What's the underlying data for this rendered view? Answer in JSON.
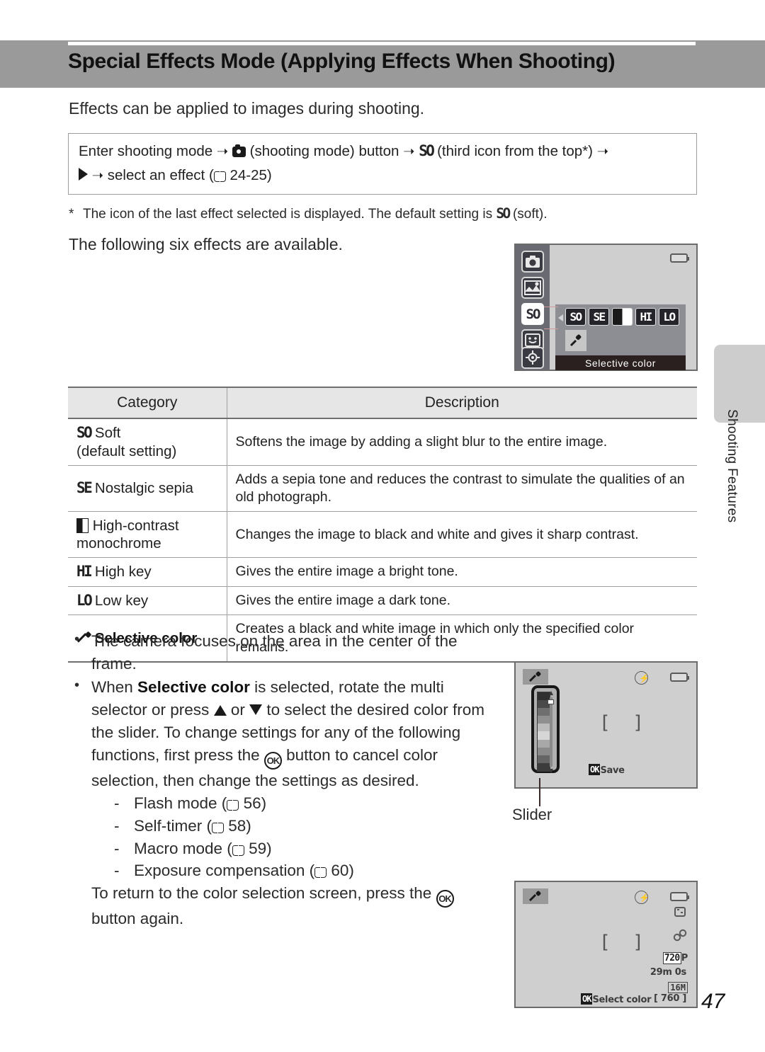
{
  "header": {
    "title": "Special Effects Mode (Applying Effects When Shooting)"
  },
  "intro": "Effects can be applied to images during shooting.",
  "command_box": {
    "line1_a": "Enter shooting mode",
    "line1_b": "(shooting mode) button",
    "line1_c": "(third icon from the top*)",
    "line2_a": "select an effect (",
    "line2_pages": "24-25)"
  },
  "footnote": {
    "marker": "*",
    "text_a": "The icon of the last effect selected is displayed. The default setting is",
    "text_b": "(soft)."
  },
  "following_line": "The following six effects are available.",
  "table": {
    "headers": [
      "Category",
      "Description"
    ],
    "rows": [
      {
        "icon": "SO",
        "category_line1": "Soft",
        "category_line2": "(default setting)",
        "description": "Softens the image by adding a slight blur to the entire image."
      },
      {
        "icon": "SE",
        "category_line1": "Nostalgic sepia",
        "category_line2": "",
        "description": "Adds a sepia tone and reduces the contrast to simulate the qualities of an old photograph."
      },
      {
        "icon": "contrast-square-icon",
        "category_line1": "High-contrast",
        "category_line2": "monochrome",
        "description": "Changes the image to black and white and gives it sharp contrast."
      },
      {
        "icon": "HI",
        "category_line1": "High key",
        "category_line2": "",
        "description": "Gives the entire image a bright tone."
      },
      {
        "icon": "LO",
        "category_line1": "Low key",
        "category_line2": "",
        "description": "Gives the entire image a dark tone."
      },
      {
        "icon": "eyedropper-icon",
        "category_line1": "Selective color",
        "category_line2": "",
        "description": "Creates a black and white image in which only the specified color remains."
      }
    ]
  },
  "bullets": {
    "b1": "The camera focuses on the area in the center of the frame.",
    "b2_a": "When",
    "b2_bold": "Selective color",
    "b2_b": "is selected, rotate the multi selector or press",
    "b2_c": "or",
    "b2_d": "to select the desired color from the slider.",
    "b2_e": "To change settings for any of the following functions, first press the",
    "b2_f": "button to cancel color selection, then change the settings as desired.",
    "sub_items": [
      {
        "label": "Flash mode (",
        "page": "56)"
      },
      {
        "label": "Self-timer (",
        "page": "58)"
      },
      {
        "label": "Macro mode (",
        "page": "59)"
      },
      {
        "label": "Exposure compensation (",
        "page": "60)"
      }
    ],
    "b2_g": "To return to the color selection screen, press the",
    "b2_h": "button again."
  },
  "side_tab": {
    "label": "Shooting Features"
  },
  "page_number": "47",
  "screens": {
    "menu": {
      "rail_icons": [
        "camera-mode-icon",
        "scene-mode-icon",
        "SO",
        "smile-mode-icon",
        "target-mode-icon"
      ],
      "selected_rail": "SO",
      "effect_icons": [
        "SO",
        "SE",
        "contrast-square-icon",
        "HI",
        "LO"
      ],
      "dropper_tile": "eyedropper-icon",
      "caption": "Selective color",
      "battery": "battery-icon"
    },
    "slider": {
      "dropper_badge": "eyedropper-icon",
      "ok_label": "OK",
      "save_label": "Save",
      "focus_brackets": "[    ]",
      "flash": "flash-off-icon",
      "battery": "battery-icon",
      "caption_label": "Slider"
    },
    "live": {
      "dropper_badge": "eyedropper-icon",
      "flash": "flash-off-icon",
      "battery": "battery-icon",
      "vr_icon": "vibration-reduction-icon",
      "macro_icon": "macro-icon",
      "movie_size": "720",
      "movie_size_suffix": "P",
      "record_time": "29m 0s",
      "image_size": "16M",
      "ok_label": "OK",
      "ok_action": "Select color",
      "shots_remaining": "[ 760 ]",
      "focus_brackets": "[    ]"
    }
  },
  "colors": {
    "header_band": "#9a9a9a",
    "table_header_bg": "#e6e6e6",
    "rule": "#6f6f6f",
    "screen_bg": "#cfcfcf",
    "rail_bg": "#6a6a72"
  }
}
